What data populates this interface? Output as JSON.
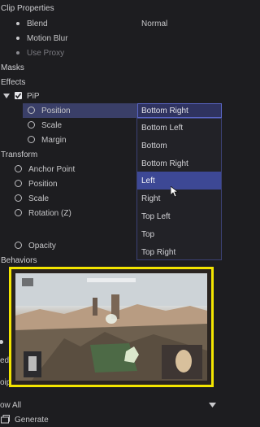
{
  "panel": {
    "clip_properties": "Clip Properties",
    "blend_label": "Blend",
    "blend_value": "Normal",
    "motion_blur": "Motion Blur",
    "use_proxy": "Use Proxy",
    "masks": "Masks",
    "effects": "Effects",
    "pip": "PiP",
    "position": "Position",
    "position_value": "Bottom Right",
    "scale": "Scale",
    "margin": "Margin",
    "transform": "Transform",
    "anchor_point": "Anchor Point",
    "t_position": "Position",
    "t_scale": "Scale",
    "rotation": "Rotation (Z)",
    "opacity": "Opacity",
    "behaviors": "Behaviors",
    "ed_partial": "ed",
    "oip_partial": "oip",
    "show_all": "ow All",
    "generate": "Generate"
  },
  "dropdown": {
    "options": [
      "Bottom Left",
      "Bottom",
      "Bottom Right",
      "Left",
      "Right",
      "Top Left",
      "Top",
      "Top Right"
    ],
    "selected": "Left"
  },
  "colors": {
    "highlight": "#f3e500",
    "accent": "#3d4895"
  }
}
